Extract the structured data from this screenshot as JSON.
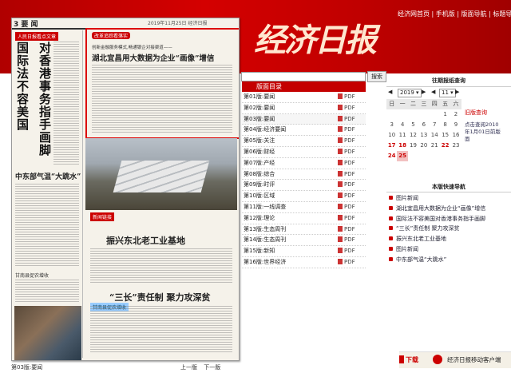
{
  "header": {
    "logo": "经济日报",
    "links": "经济网首页 | 手机版 | 版面导航 | 标题导航"
  },
  "paper": {
    "page_num": "3",
    "section": "要 闻",
    "page_title": "2019年11月25日 经济日报",
    "left_tag": "人民日报看点文章",
    "left_headline_a": "国际法不容美国",
    "left_headline_b": "对香港事务指手画脚",
    "left_sub": "中东部气温“大跳水”",
    "left_small": "甘南县促农增收",
    "highlight_tag": "改革追踪看落实",
    "highlight_sub": "创新金融服务模式,畅通银企对接渠道——",
    "highlight_title": "湖北宜昌用大数据为企业“画像”增信",
    "mid_tag": "新闻链接",
    "mid_headline": "振兴东北老工业基地",
    "mid_tag2": "甘南县促农增收",
    "mid_headline2": "“三长”责任制 聚力攻深贫",
    "footer_label": "第03版:要闻",
    "prev": "上一版",
    "next": "下一版"
  },
  "search": {
    "placeholder": "",
    "button": "搜索"
  },
  "editions": {
    "title": "版面目录",
    "pdf": "PDF",
    "items": [
      {
        "label": "第01版:要闻"
      },
      {
        "label": "第02版:要闻"
      },
      {
        "label": "第03版:要闻"
      },
      {
        "label": "第04版:经济要闻"
      },
      {
        "label": "第05版:关注"
      },
      {
        "label": "第06版:财经"
      },
      {
        "label": "第07版:产经"
      },
      {
        "label": "第08版:综合"
      },
      {
        "label": "第09版:时评"
      },
      {
        "label": "第10版:区域"
      },
      {
        "label": "第11版:一线调查"
      },
      {
        "label": "第12版:理论"
      },
      {
        "label": "第13版:生态周刊"
      },
      {
        "label": "第14版:生态周刊"
      },
      {
        "label": "第15版:新知"
      },
      {
        "label": "第16版:世界经济"
      }
    ]
  },
  "calendar": {
    "title": "往期报纸查询",
    "year": "2019",
    "month": "11",
    "weekdays": [
      "日",
      "一",
      "二",
      "三",
      "四",
      "五",
      "六"
    ],
    "days": [
      "",
      "",
      "",
      "",
      "",
      "1",
      "2",
      "3",
      "4",
      "5",
      "6",
      "7",
      "8",
      "9",
      "10",
      "11",
      "12",
      "13",
      "14",
      "15",
      "16",
      "17",
      "18",
      "19",
      "20",
      "21",
      "22",
      "23",
      "24",
      "25",
      "",
      "",
      "",
      "",
      ""
    ],
    "old_title": "旧版查询",
    "old_text": "点击查阅2010年1月01日前版面"
  },
  "nav": {
    "title": "本版快速导航",
    "items": [
      "图片新闻",
      "湖北宜昌用大数据为企业“画像”增信",
      "国际法不容美国对香港事务指手画脚",
      "“三长”责任制 聚力攻深贫",
      "振兴东北老工业基地",
      "图片新闻",
      "中东部气温“大跳水”"
    ]
  },
  "download": {
    "label": "下载",
    "text": "经济日报移动客户端"
  },
  "colors": {
    "brand_red": "#c40000",
    "header_red": "#d40000"
  }
}
